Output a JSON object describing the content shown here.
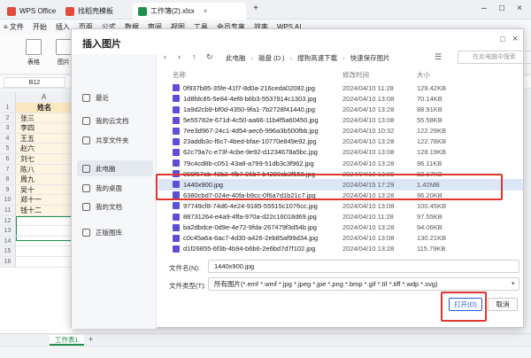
{
  "titlebar": {
    "tabs": [
      {
        "label": "WPS Office",
        "color": "#e14b3b"
      },
      {
        "label": "找稻壳模板",
        "color": "#e14b3b"
      },
      {
        "label": "工作簿(2).xlsx",
        "color": "#1f8f4e"
      }
    ],
    "new_tab": "+",
    "menu_icon": "≡"
  },
  "menubar": {
    "items": [
      "≡ 文件",
      "开始",
      "插入",
      "页面",
      "公式",
      "数据",
      "审阅",
      "视图",
      "工具",
      "会员专享",
      "效率",
      "WPS AI"
    ]
  },
  "ribbon": {
    "items": [
      "表格",
      "图片"
    ]
  },
  "formula": {
    "cellref": "B12"
  },
  "grid": {
    "col_b": "A",
    "col_header": "姓名",
    "rows": [
      {
        "num": "1",
        "val": "姓名"
      },
      {
        "num": "2",
        "val": "张三"
      },
      {
        "num": "3",
        "val": "李四"
      },
      {
        "num": "4",
        "val": "王五"
      },
      {
        "num": "5",
        "val": "赵六"
      },
      {
        "num": "6",
        "val": "刘七"
      },
      {
        "num": "7",
        "val": "陈八"
      },
      {
        "num": "8",
        "val": "周九"
      },
      {
        "num": "9",
        "val": "吴十"
      },
      {
        "num": "10",
        "val": "郑十一"
      },
      {
        "num": "11",
        "val": "钱十二"
      },
      {
        "num": "12",
        "val": ""
      },
      {
        "num": "13",
        "val": ""
      },
      {
        "num": "14",
        "val": ""
      },
      {
        "num": "15",
        "val": ""
      },
      {
        "num": "16",
        "val": ""
      }
    ]
  },
  "sheetbar": {
    "sheet": "工作表1",
    "add": "+"
  },
  "dialog": {
    "title": "插入图片",
    "close": "×",
    "max": "□",
    "sidebar": [
      {
        "label": "最近",
        "icon": "clock-icon"
      },
      {
        "label": "我的云文档",
        "icon": "cloud-icon"
      },
      {
        "label": "共享文件夹",
        "icon": "share-icon"
      },
      {
        "label": "此电脑",
        "icon": "computer-icon",
        "active": true
      },
      {
        "label": "我的桌面",
        "icon": "desktop-icon"
      },
      {
        "label": "我的文档",
        "icon": "documents-icon"
      },
      {
        "label": "正版图库",
        "icon": "gallery-icon"
      }
    ],
    "breadcrumb": [
      "此电脑",
      "磁盘 (D:)",
      "搜狗高速下载",
      "快速保存图片"
    ],
    "search_placeholder": "在此电脑中搜索",
    "columns": {
      "name": "名称",
      "date": "修改时间",
      "size": "大小"
    },
    "files": [
      {
        "name": "0f937b85-35fe-41f7-8d0a-216ceda02082.jpg",
        "date": "2024/04/10 11:28",
        "size": "129.42KB"
      },
      {
        "name": "1d8fdc85-5e84-4ef8-b6b3-5537914c1303.jpg",
        "date": "2024/04/10 13:08",
        "size": "70.14KB"
      },
      {
        "name": "1a9d2cb9-bf0d-4350-9fa1-7b2728f41440.jpg",
        "date": "2024/04/10 13:28",
        "size": "88.91KB"
      },
      {
        "name": "5e55782e-671d-4c50-aa66-11b4f5a60450.jpg",
        "date": "2024/04/10 13:08",
        "size": "55.58KB"
      },
      {
        "name": "7ee3d967-24c1-4d54-aec6-996a3b500fbb.jpg",
        "date": "2024/04/10 10:32",
        "size": "122.29KB"
      },
      {
        "name": "23addb3c-f6c7-4bed-bfae-10770e849e92.jpg",
        "date": "2024/04/10 13:28",
        "size": "122.78KB"
      },
      {
        "name": "62c79a7c-e73f-4cbe-9e92-d1234678a5bc.jpg",
        "date": "2024/04/10 13:08",
        "size": "128.19KB"
      },
      {
        "name": "79c4cd8b-c051-43a8-a799-51db3c3f962.jpg",
        "date": "2024/04/10 13:28",
        "size": "96.11KB"
      },
      {
        "name": "999f67eb-49b2-4fb7-96b7-b4290cb3f558.jpg",
        "date": "2024/04/10 13:08",
        "size": "92.17KB"
      },
      {
        "name": "1440x900.jpg",
        "date": "2024/04/15 17:29",
        "size": "1.42MB",
        "selected": true
      },
      {
        "name": "6380cbd7-024e-40fa-b9cc-0f6a7d1b21c7.jpg",
        "date": "2024/04/10 13:28",
        "size": "96.20KB"
      },
      {
        "name": "97749cf8-74d6-4e24-9185-55515c1076cc.jpg",
        "date": "2024/04/10 13:08",
        "size": "100.45KB"
      },
      {
        "name": "88731264-e4a9-4ffa-970a-d22c16018d69.jpg",
        "date": "2024/04/10 11:28",
        "size": "97.55KB"
      },
      {
        "name": "ba2dbdce-0d9e-4e72-9fda-267479f3d54b.jpg",
        "date": "2024/04/10 13:28",
        "size": "94.06KB"
      },
      {
        "name": "c0c45a6a-6ac7-4d30-a426-2eb85af99d34.jpg",
        "date": "2024/04/10 13:08",
        "size": "130.21KB"
      },
      {
        "name": "d1f26855-6f3b-4b94-b6b6-2e6bd7d7f102.jpg",
        "date": "2024/04/10 13:28",
        "size": "115.79KB"
      }
    ],
    "filename_label": "文件名(N):",
    "filename_value": "1440x900.jpg",
    "filetype_label": "文件类型(T):",
    "filetype_value": "所有图片(*.emf *.wmf *.jpg *.jpeg *.jpe *.png *.bmp *.gif *.tif *.tiff *.wdp *.svg)",
    "open_label": "打开(O)",
    "cancel_label": "取消"
  }
}
